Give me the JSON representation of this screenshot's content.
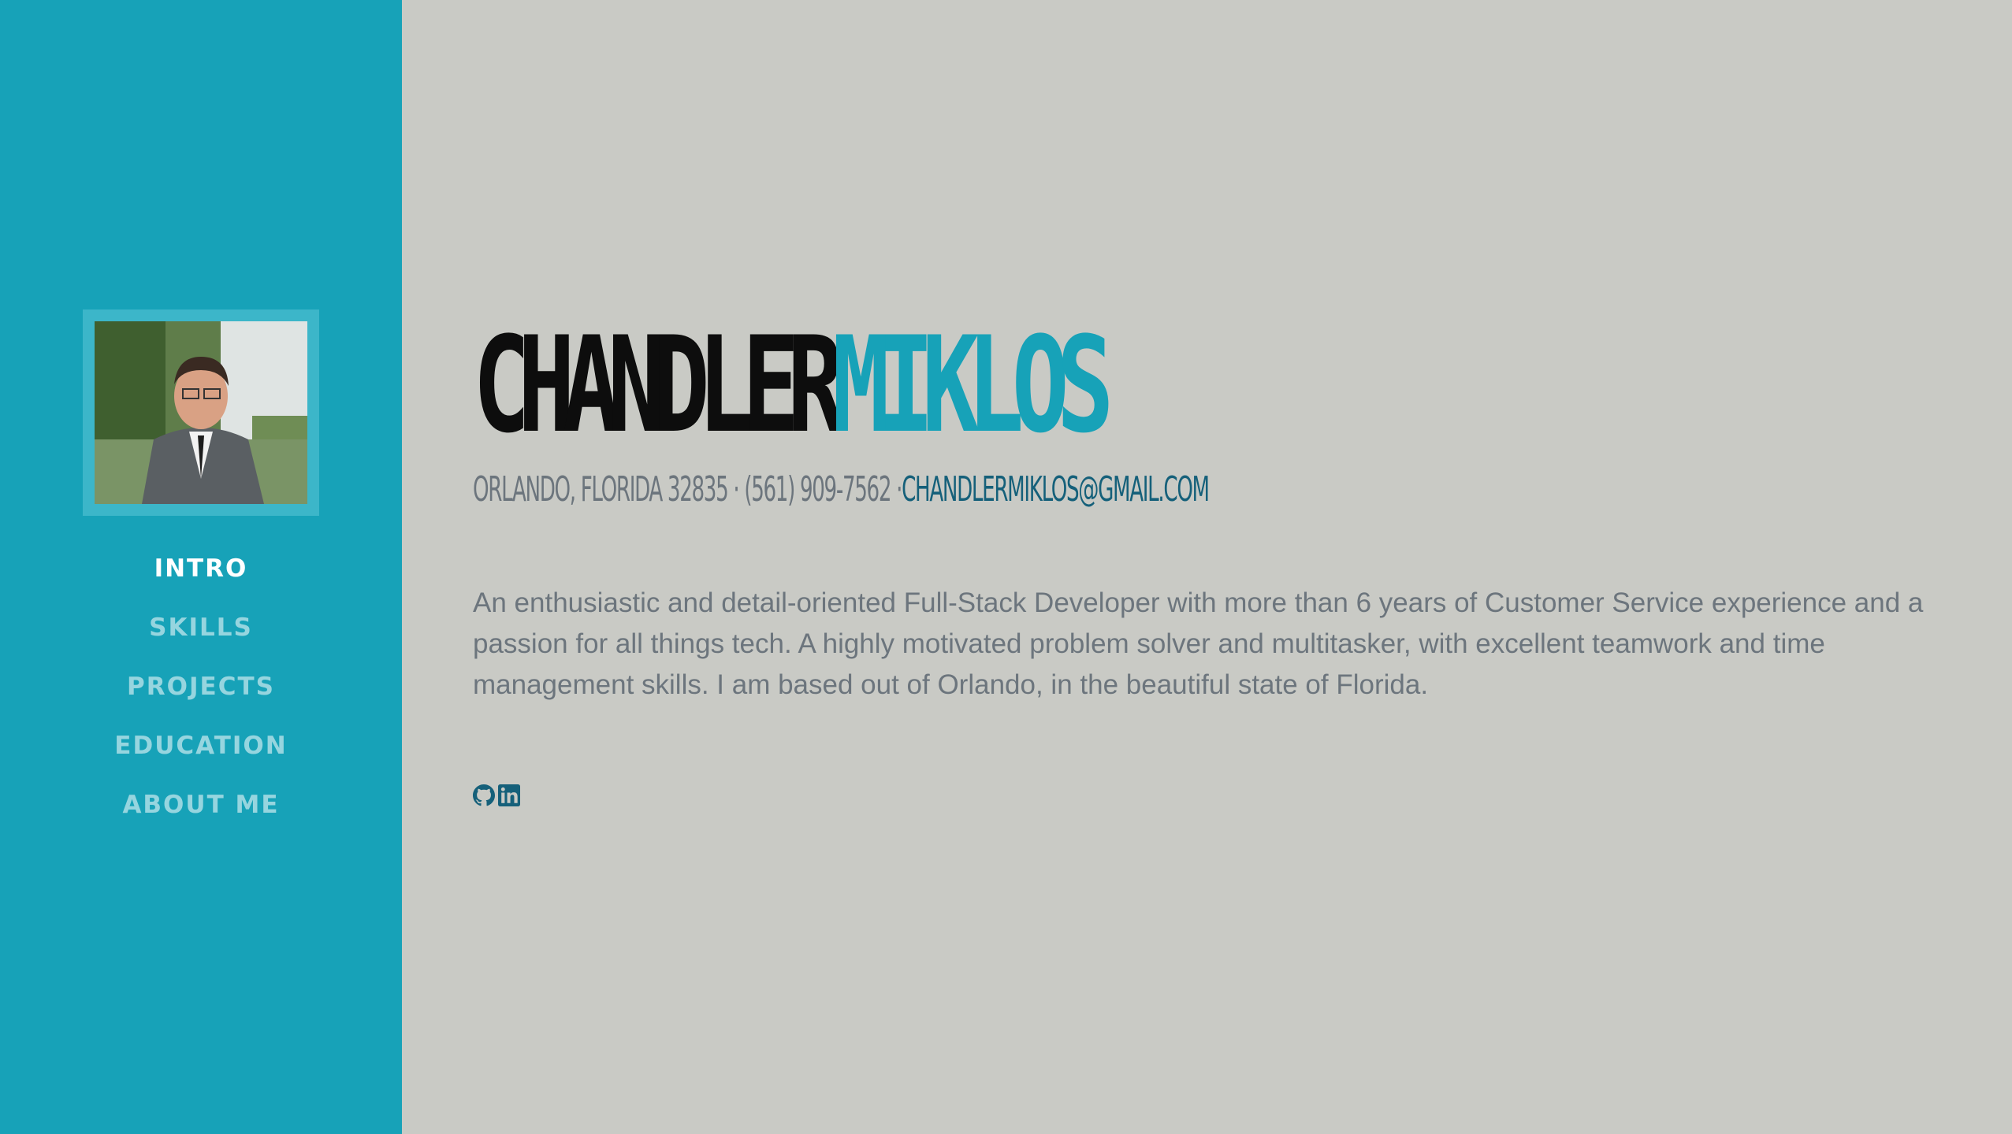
{
  "sidebar": {
    "background": "#17a2b8",
    "avatar_icon": "profile-photo",
    "nav": [
      {
        "label": "INTRO",
        "active": true
      },
      {
        "label": "SKILLS",
        "active": false
      },
      {
        "label": "PROJECTS",
        "active": false
      },
      {
        "label": "EDUCATION",
        "active": false
      },
      {
        "label": "ABOUT ME",
        "active": false
      }
    ]
  },
  "header": {
    "first_name": "CHANDLER",
    "last_name": "MIKLOS",
    "location": "ORLANDO, FLORIDA 32835",
    "separator": " · ",
    "phone": "(561) 909-7562",
    "separator_email": " ·",
    "email": "CHANDLERMIKLOS@GMAIL.COM"
  },
  "intro": {
    "text": "An enthusiastic and detail-oriented Full-Stack Developer with more than 6 years of Customer Service experience and a passion for all things tech. A highly motivated problem solver and multitasker, with excellent teamwork and time management skills. I am based out of Orlando, in the beautiful state of Florida."
  },
  "social": {
    "icons": [
      "github-icon",
      "linkedin-icon"
    ]
  },
  "colors": {
    "accent": "#17a2b8",
    "background": "#c9cac5",
    "text_muted": "#6c757d",
    "link": "#15607a"
  }
}
